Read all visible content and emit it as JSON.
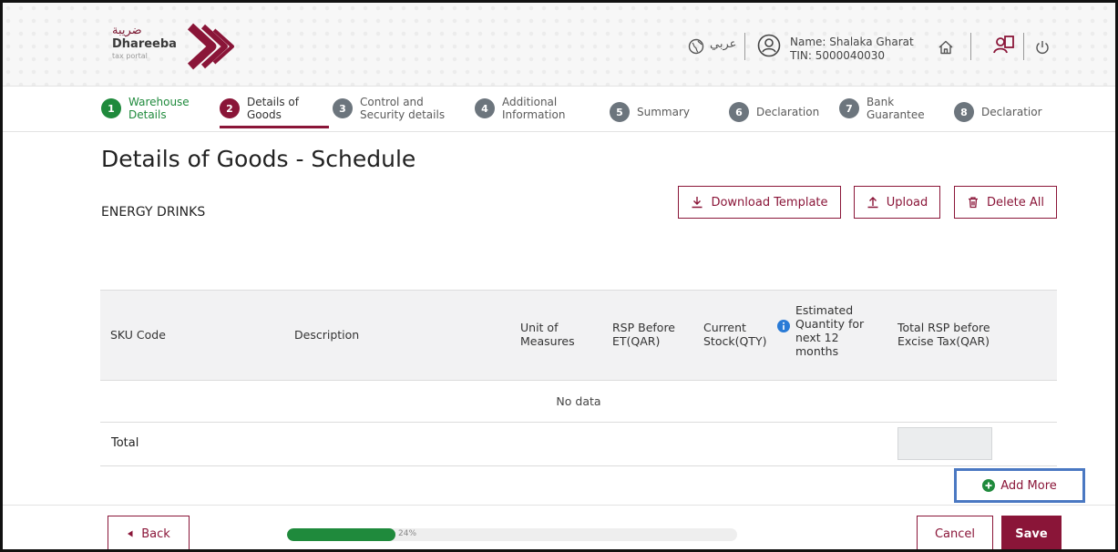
{
  "header": {
    "logo_arabic": "ضريبة",
    "logo_name": "Dhareeba",
    "logo_sub": "tax portal",
    "language": "عربي",
    "user_name": "Name: Shalaka Gharat",
    "user_tin": "TIN: 5000040030"
  },
  "stepper": {
    "steps": [
      {
        "num": "1",
        "label1": "Warehouse",
        "label2": "Details",
        "state": "done"
      },
      {
        "num": "2",
        "label1": "Details of",
        "label2": "Goods",
        "state": "active"
      },
      {
        "num": "3",
        "label1": "Control and",
        "label2": "Security details",
        "state": "pending"
      },
      {
        "num": "4",
        "label1": "Additional",
        "label2": "Information",
        "state": "pending"
      },
      {
        "num": "5",
        "label1": "Summary",
        "label2": "",
        "state": "pending"
      },
      {
        "num": "6",
        "label1": "Declaration",
        "label2": "",
        "state": "pending"
      },
      {
        "num": "7",
        "label1": "Bank",
        "label2": "Guarantee",
        "state": "pending"
      },
      {
        "num": "8",
        "label1": "Declaratior",
        "label2": "",
        "state": "pending"
      }
    ]
  },
  "main": {
    "title": "Details of Goods - Schedule",
    "subtitle": "ENERGY DRINKS",
    "download_label": "Download Template",
    "upload_label": "Upload",
    "delete_all_label": "Delete All"
  },
  "table": {
    "columns": [
      {
        "l1": "SKU Code",
        "l2": "",
        "l3": "",
        "l4": ""
      },
      {
        "l1": "Description",
        "l2": "",
        "l3": "",
        "l4": ""
      },
      {
        "l1": "Unit of",
        "l2": "Measures",
        "l3": "",
        "l4": ""
      },
      {
        "l1": "RSP Before",
        "l2": "ET(QAR)",
        "l3": "",
        "l4": ""
      },
      {
        "l1": "Current",
        "l2": "Stock(QTY)",
        "l3": "",
        "l4": ""
      },
      {
        "l1": "Estimated",
        "l2": "Quantity for",
        "l3": "next 12",
        "l4": "months"
      },
      {
        "l1": "Total RSP before",
        "l2": "Excise Tax(QAR)",
        "l3": "",
        "l4": ""
      }
    ],
    "empty_text": "No data",
    "total_label": "Total",
    "total_value": ""
  },
  "add_more_label": "Add More",
  "footer": {
    "back_label": "Back",
    "progress_value": 24,
    "progress_text": "24%",
    "cancel_label": "Cancel",
    "save_label": "Save"
  },
  "colors": {
    "brand": "#8a1538",
    "success": "#1f8a3c",
    "highlight": "#4a78c2"
  },
  "icons": [
    "globe-icon",
    "user-circle-icon",
    "home-icon",
    "switch-role-icon",
    "power-icon",
    "download-icon",
    "upload-icon",
    "trash-icon",
    "info-icon",
    "plus-circle-icon",
    "caret-left-icon"
  ]
}
